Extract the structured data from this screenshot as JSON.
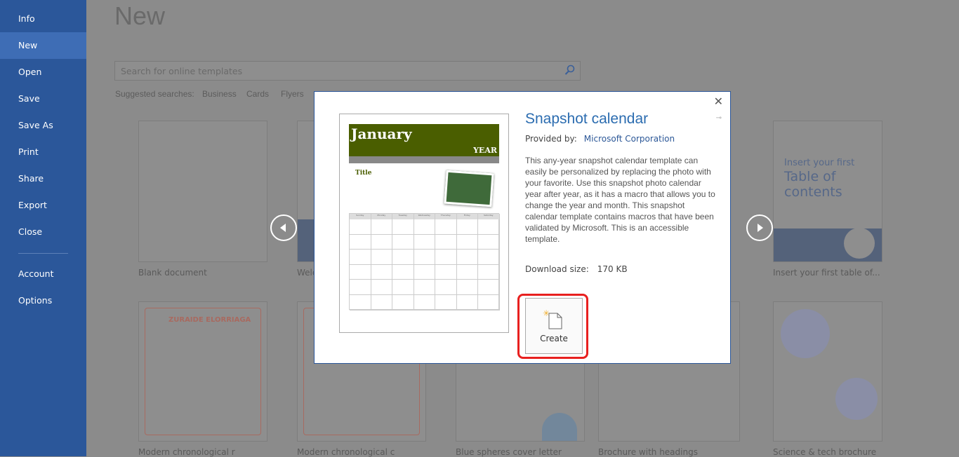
{
  "sidebar": {
    "items": [
      {
        "label": "Info"
      },
      {
        "label": "New",
        "active": true
      },
      {
        "label": "Open"
      },
      {
        "label": "Save"
      },
      {
        "label": "Save As"
      },
      {
        "label": "Print"
      },
      {
        "label": "Share"
      },
      {
        "label": "Export"
      },
      {
        "label": "Close"
      },
      {
        "label": "Account"
      },
      {
        "label": "Options"
      }
    ]
  },
  "main": {
    "title": "New",
    "search_placeholder": "Search for online templates",
    "suggested_label": "Suggested searches:",
    "suggested": [
      "Business",
      "Cards",
      "Flyers"
    ],
    "templates": [
      {
        "label": "Blank document"
      },
      {
        "label": "Welc"
      },
      {
        "label": "Insert your first table of..."
      },
      {
        "label": "Modern chronological r"
      },
      {
        "label": "Modern chronological c"
      },
      {
        "label": "Blue spheres cover letter"
      },
      {
        "label": "Brochure with headings"
      },
      {
        "label": "Science & tech brochure"
      }
    ],
    "toc_thumb": {
      "line1": "Insert your first",
      "line2": "Table of",
      "line3": "contents"
    },
    "resume_thumb": {
      "name": "ZURAIDE ELORRIAGA"
    }
  },
  "dialog": {
    "title": "Snapshot calendar",
    "provided_label": "Provided by:",
    "provider": "Microsoft Corporation",
    "description": "This any-year snapshot calendar template can easily be personalized by replacing the photo with your favorite. Use this snapshot photo calendar year after year, as it has a macro that allows you to change the year and month. This snapshot calendar template contains macros that have been validated by Microsoft. This is an accessible template.",
    "download_label": "Download size:",
    "download_size": "170 KB",
    "create_label": "Create",
    "preview": {
      "month": "January",
      "year": "YEAR",
      "heading": "Title",
      "days": [
        "Sunday",
        "Monday",
        "Tuesday",
        "Wednesday",
        "Thursday",
        "Friday",
        "Saturday"
      ]
    }
  },
  "colors": {
    "sidebar": "#2b579a",
    "sidebar_active": "#3e6db5",
    "accent": "#2b6cb0",
    "highlight": "#e8201f",
    "calendar_banner": "#4a5e00"
  }
}
